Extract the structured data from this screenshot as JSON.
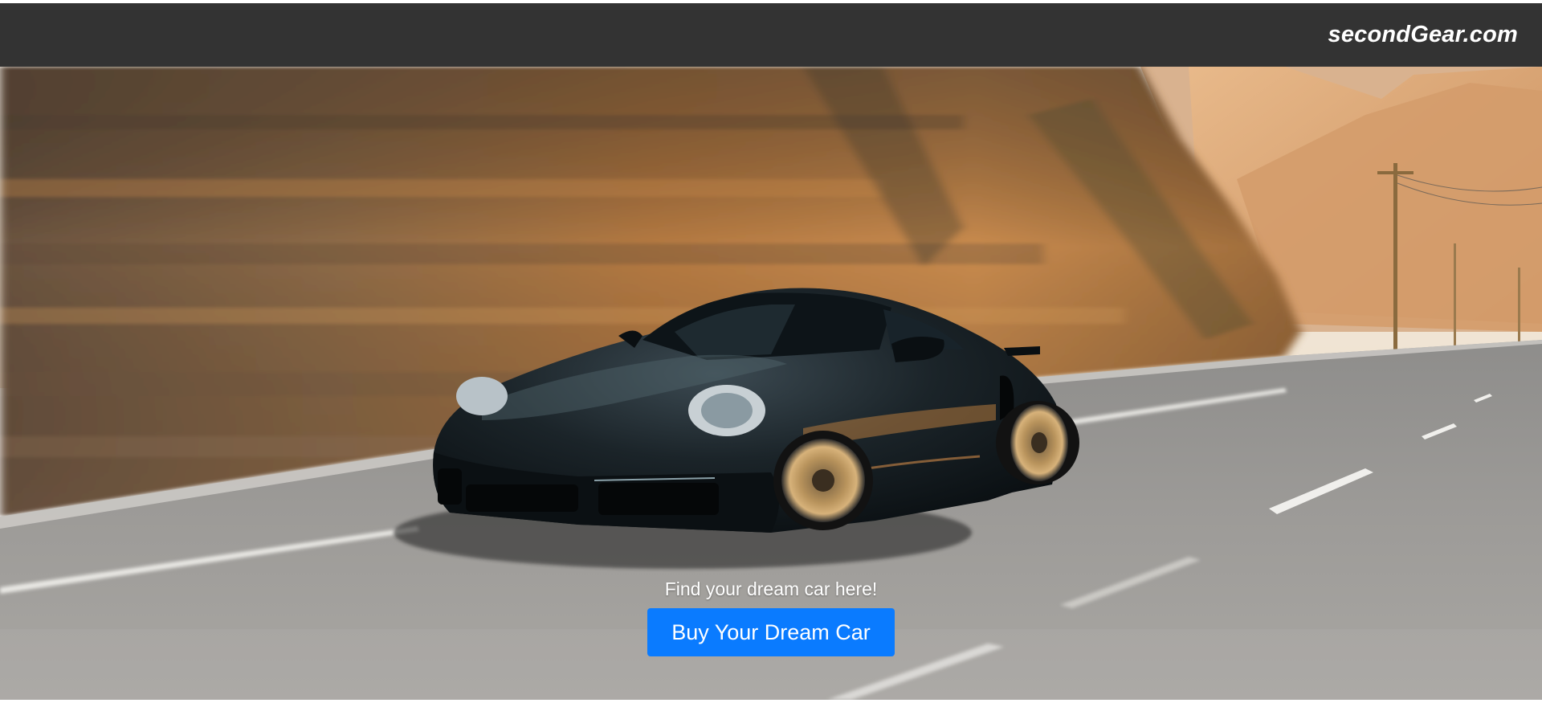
{
  "header": {
    "brand": "secondGear.com",
    "background_color": "#333333"
  },
  "hero": {
    "image_semantic": "black-sports-car-on-mountain-road-photo",
    "tagline": "Find your dream car here!",
    "cta_label": "Buy Your Dream Car",
    "cta_color": "#0a7bff"
  }
}
